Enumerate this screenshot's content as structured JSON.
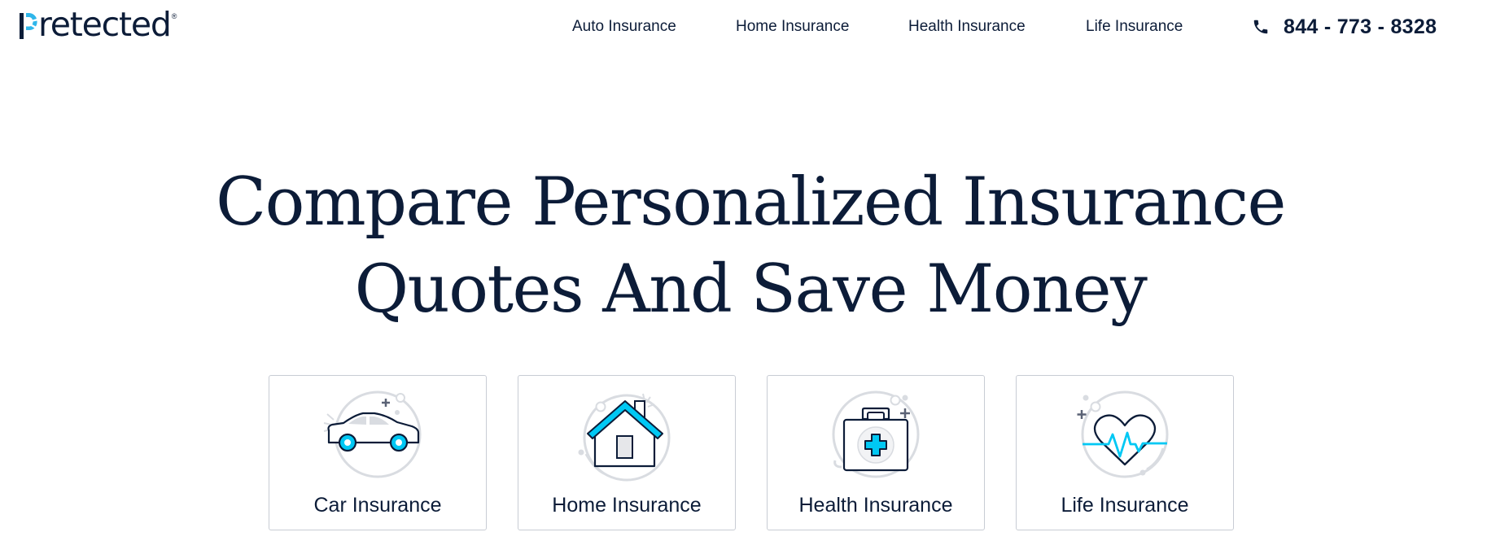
{
  "header": {
    "logo": {
      "text": "retected",
      "initial": "P",
      "registered_mark": "®",
      "brand_name": "Pretected"
    },
    "nav": [
      {
        "label": "Auto Insurance"
      },
      {
        "label": "Home Insurance"
      },
      {
        "label": "Health Insurance"
      },
      {
        "label": "Life Insurance"
      }
    ],
    "phone": {
      "icon": "phone-icon",
      "number": "844 - 773 - 8328"
    }
  },
  "hero": {
    "headline_line1": "Compare Personalized Insurance",
    "headline_line2": "Quotes And Save Money"
  },
  "cards": [
    {
      "label": "Car Insurance",
      "icon": "car-icon"
    },
    {
      "label": "Home Insurance",
      "icon": "house-icon"
    },
    {
      "label": "Health Insurance",
      "icon": "medical-kit-icon"
    },
    {
      "label": "Life Insurance",
      "icon": "heartbeat-icon"
    }
  ],
  "colors": {
    "navy": "#0c1c38",
    "accent_cyan": "#00c8f4",
    "icon_gray": "#d9dce1",
    "card_border": "#c8ccd4"
  }
}
